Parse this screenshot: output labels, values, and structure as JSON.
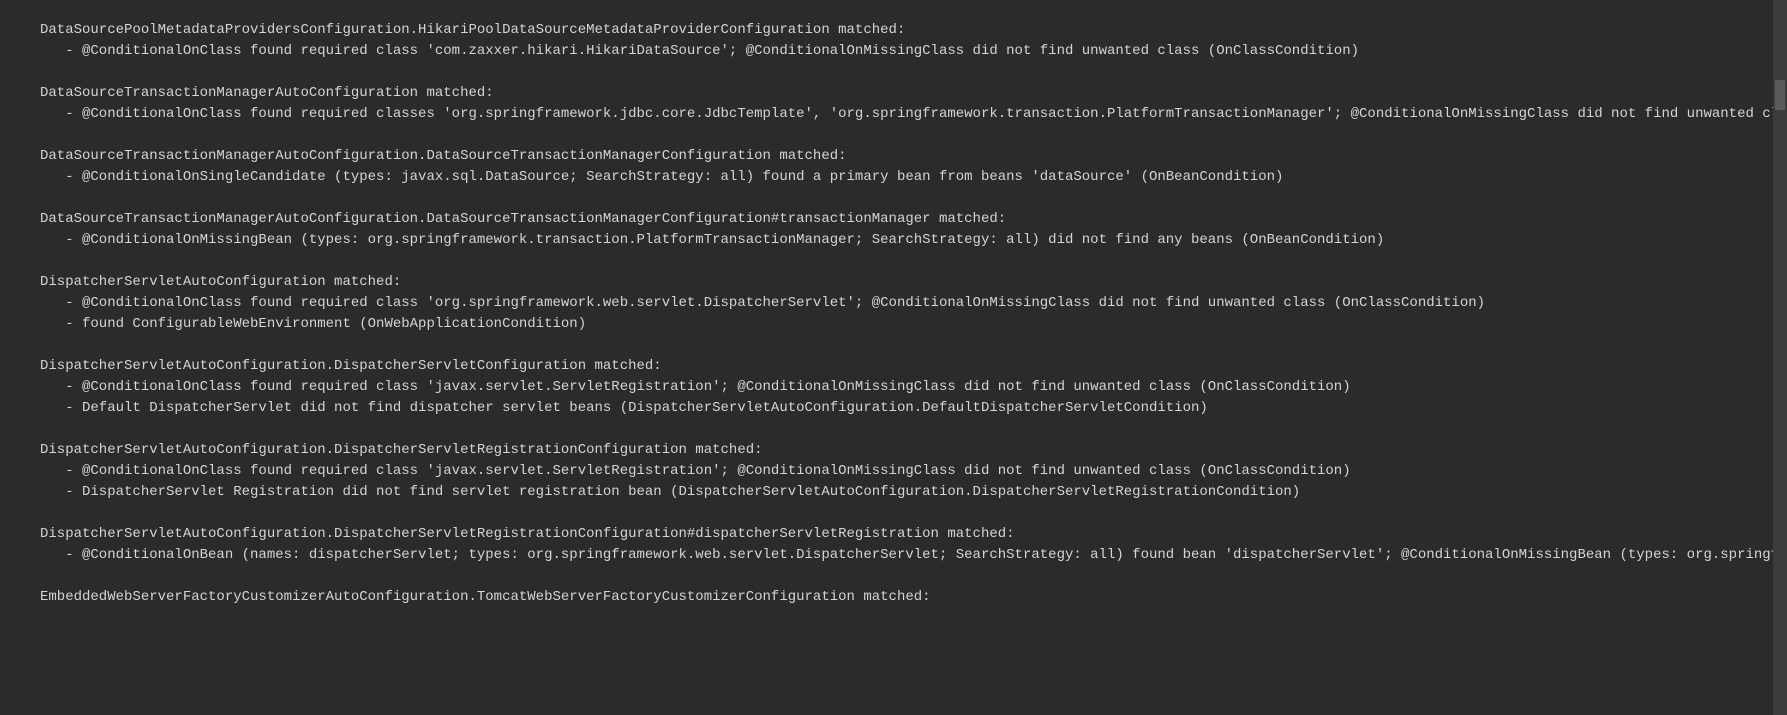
{
  "log": {
    "blocks": [
      {
        "header": "DataSourcePoolMetadataProvidersConfiguration.HikariPoolDataSourceMetadataProviderConfiguration matched:",
        "items": [
          "   - @ConditionalOnClass found required class 'com.zaxxer.hikari.HikariDataSource'; @ConditionalOnMissingClass did not find unwanted class (OnClassCondition)"
        ]
      },
      {
        "header": "DataSourceTransactionManagerAutoConfiguration matched:",
        "items": [
          "   - @ConditionalOnClass found required classes 'org.springframework.jdbc.core.JdbcTemplate', 'org.springframework.transaction.PlatformTransactionManager'; @ConditionalOnMissingClass did not find unwanted class (OnClassCondition)"
        ]
      },
      {
        "header": "DataSourceTransactionManagerAutoConfiguration.DataSourceTransactionManagerConfiguration matched:",
        "items": [
          "   - @ConditionalOnSingleCandidate (types: javax.sql.DataSource; SearchStrategy: all) found a primary bean from beans 'dataSource' (OnBeanCondition)"
        ]
      },
      {
        "header": "DataSourceTransactionManagerAutoConfiguration.DataSourceTransactionManagerConfiguration#transactionManager matched:",
        "items": [
          "   - @ConditionalOnMissingBean (types: org.springframework.transaction.PlatformTransactionManager; SearchStrategy: all) did not find any beans (OnBeanCondition)"
        ]
      },
      {
        "header": "DispatcherServletAutoConfiguration matched:",
        "items": [
          "   - @ConditionalOnClass found required class 'org.springframework.web.servlet.DispatcherServlet'; @ConditionalOnMissingClass did not find unwanted class (OnClassCondition)",
          "   - found ConfigurableWebEnvironment (OnWebApplicationCondition)"
        ]
      },
      {
        "header": "DispatcherServletAutoConfiguration.DispatcherServletConfiguration matched:",
        "items": [
          "   - @ConditionalOnClass found required class 'javax.servlet.ServletRegistration'; @ConditionalOnMissingClass did not find unwanted class (OnClassCondition)",
          "   - Default DispatcherServlet did not find dispatcher servlet beans (DispatcherServletAutoConfiguration.DefaultDispatcherServletCondition)"
        ]
      },
      {
        "header": "DispatcherServletAutoConfiguration.DispatcherServletRegistrationConfiguration matched:",
        "items": [
          "   - @ConditionalOnClass found required class 'javax.servlet.ServletRegistration'; @ConditionalOnMissingClass did not find unwanted class (OnClassCondition)",
          "   - DispatcherServlet Registration did not find servlet registration bean (DispatcherServletAutoConfiguration.DispatcherServletRegistrationCondition)"
        ]
      },
      {
        "header": "DispatcherServletAutoConfiguration.DispatcherServletRegistrationConfiguration#dispatcherServletRegistration matched:",
        "items": [
          "   - @ConditionalOnBean (names: dispatcherServlet; types: org.springframework.web.servlet.DispatcherServlet; SearchStrategy: all) found bean 'dispatcherServlet'; @ConditionalOnMissingBean (types: org.springframework.boot.autoconfigure.web.servlet.DispatcherServletRegistrationBean; SearchStrategy: all) did not find any beans (OnBeanCondition)"
        ]
      },
      {
        "header": "EmbeddedWebServerFactoryCustomizerAutoConfiguration.TomcatWebServerFactoryCustomizerConfiguration matched:",
        "items": []
      }
    ]
  },
  "scrollbar": {
    "thumbTop": "80px",
    "thumbHeight": "30px"
  }
}
